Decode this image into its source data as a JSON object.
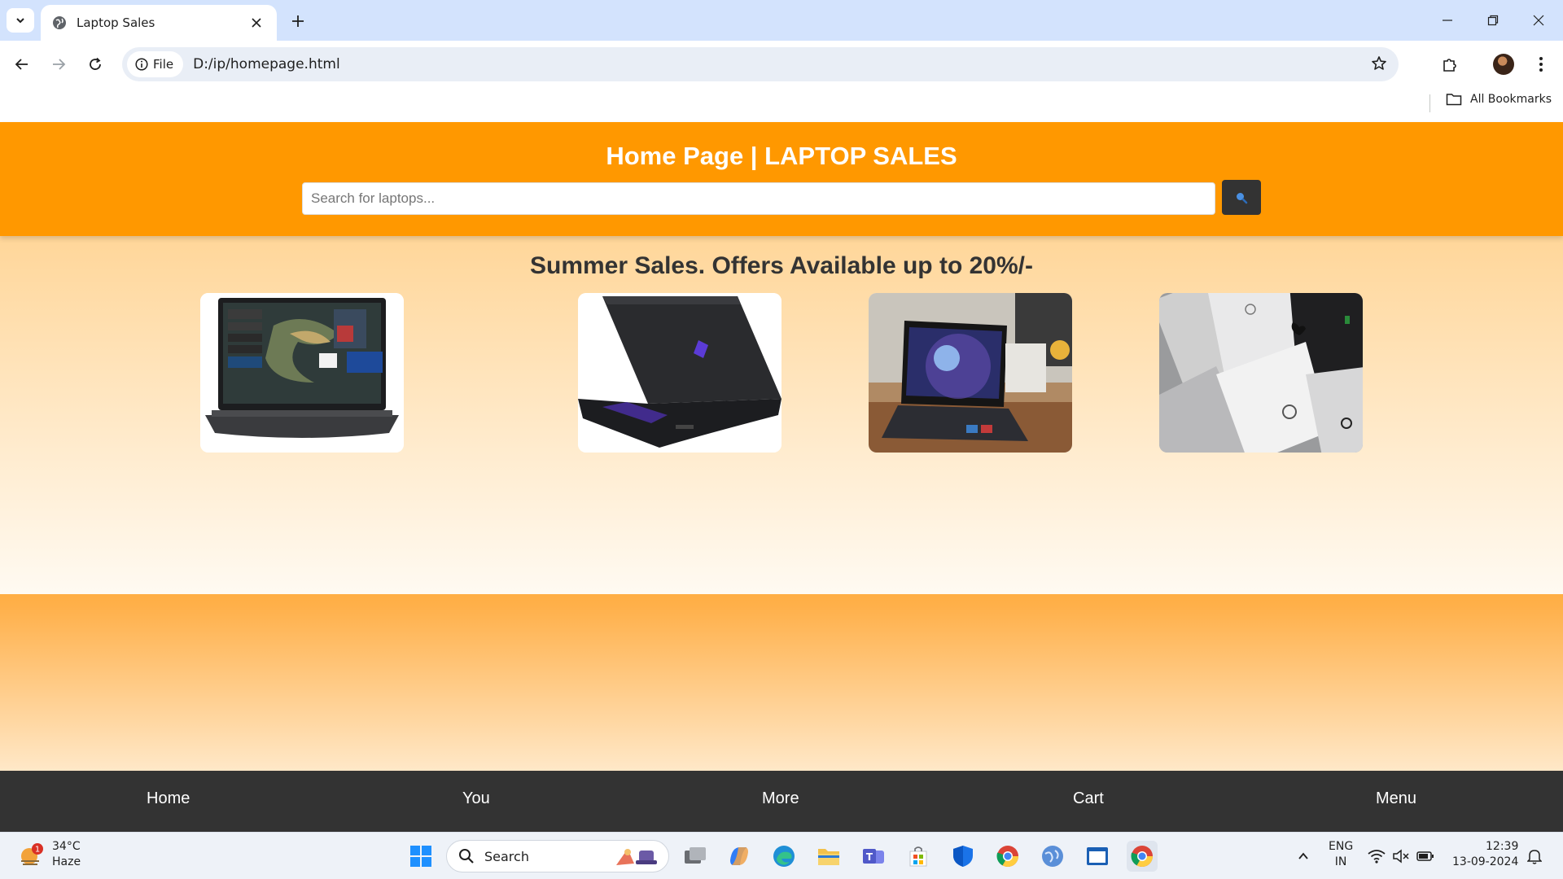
{
  "browser": {
    "tab_title": "Laptop Sales",
    "chip_label": "File",
    "url": "D:/ip/homepage.html",
    "all_bookmarks": "All Bookmarks"
  },
  "site": {
    "title": "Home Page | LAPTOP SALES",
    "search_placeholder": "Search for laptops...",
    "promo_title": "Summer Sales. Offers Available up to 20%/-",
    "products": [
      {
        "icon": "gaming-laptop-front-image"
      },
      {
        "icon": "black-laptop-rear-image"
      },
      {
        "icon": "laptop-on-desk-image"
      },
      {
        "icon": "laptop-lids-collage-image"
      }
    ],
    "footer": [
      "Home",
      "You",
      "More",
      "Cart",
      "Menu"
    ],
    "colors": {
      "header": "#ff9800",
      "footer": "#333333",
      "search_button": "#333333"
    }
  },
  "taskbar": {
    "weather_temp": "34°C",
    "weather_desc": "Haze",
    "weather_badge": "1",
    "search_label": "Search",
    "lang_top": "ENG",
    "lang_bottom": "IN",
    "time": "12:39",
    "date": "13-09-2024"
  }
}
